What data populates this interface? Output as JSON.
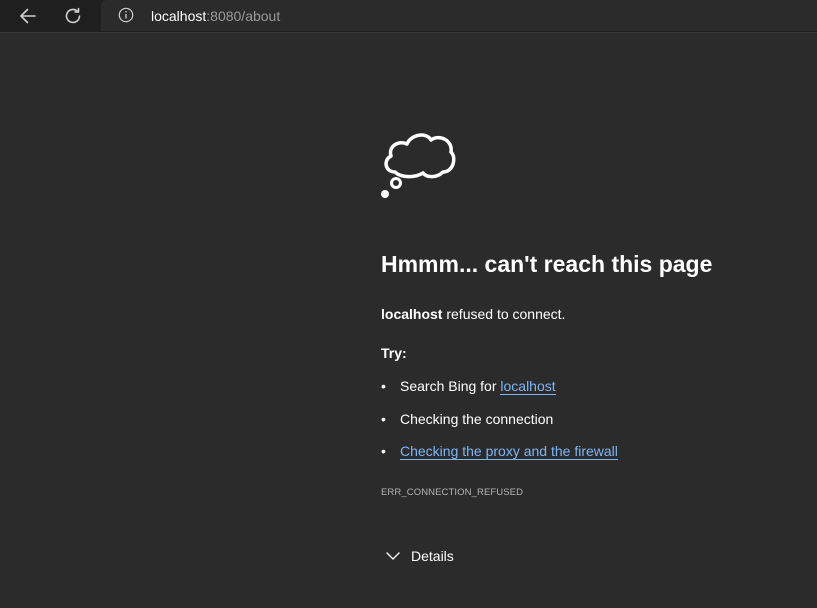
{
  "toolbar": {
    "back_icon": "back-arrow-icon",
    "refresh_icon": "refresh-icon",
    "info_icon": "info-icon",
    "url_host": "localhost",
    "url_rest": ":8080/about"
  },
  "error": {
    "icon": "thought-cloud-icon",
    "heading": "Hmmm... can't reach this page",
    "host": "localhost",
    "message": " refused to connect.",
    "try_label": "Try:",
    "suggestions": [
      {
        "prefix": "Search Bing for ",
        "link": "localhost"
      },
      {
        "text": "Checking the connection"
      },
      {
        "link": "Checking the proxy and the firewall"
      }
    ],
    "code": "ERR_CONNECTION_REFUSED",
    "details_label": "Details"
  },
  "colors": {
    "background": "#2b2b2b",
    "toolbar": "#1f1f1f",
    "link": "#7eb6f5",
    "text": "#ffffff",
    "muted": "#9a9a9a"
  }
}
